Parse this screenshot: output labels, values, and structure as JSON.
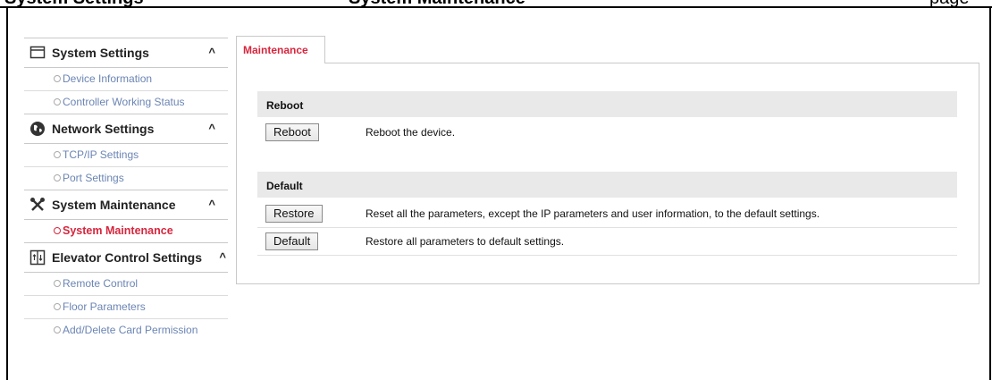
{
  "top_fragment": {
    "left": "System Settings",
    "middle": "System Maintenance",
    "right": "page"
  },
  "sidebar": {
    "sections": [
      {
        "title": "System Settings",
        "icon": "window-icon",
        "caret": "^",
        "items": [
          {
            "label": "Device Information",
            "active": false
          },
          {
            "label": "Controller Working Status",
            "active": false
          }
        ]
      },
      {
        "title": "Network Settings",
        "icon": "globe-icon",
        "caret": "^",
        "items": [
          {
            "label": "TCP/IP Settings",
            "active": false
          },
          {
            "label": "Port Settings",
            "active": false
          }
        ]
      },
      {
        "title": "System Maintenance",
        "icon": "tools-icon",
        "caret": "^",
        "items": [
          {
            "label": "System Maintenance",
            "active": true
          }
        ]
      },
      {
        "title": "Elevator Control Settings",
        "icon": "elevator-icon",
        "caret": "^",
        "items": [
          {
            "label": "Remote Control",
            "active": false
          },
          {
            "label": "Floor Parameters",
            "active": false
          },
          {
            "label": "Add/Delete Card Permission",
            "active": false
          }
        ]
      }
    ]
  },
  "main": {
    "tab_label": "Maintenance",
    "reboot_section": {
      "title": "Reboot",
      "button": "Reboot",
      "description": "Reboot the device."
    },
    "default_section": {
      "title": "Default",
      "restore_button": "Restore",
      "restore_description": "Reset all the parameters, except the IP parameters and user information, to the default settings.",
      "default_button": "Default",
      "default_description": "Restore all parameters to default settings."
    }
  },
  "colors": {
    "accent_red": "#d7263d",
    "link_blue": "#6b85b4",
    "section_gray": "#e9e9e9",
    "border_gray": "#c9c9c9"
  }
}
